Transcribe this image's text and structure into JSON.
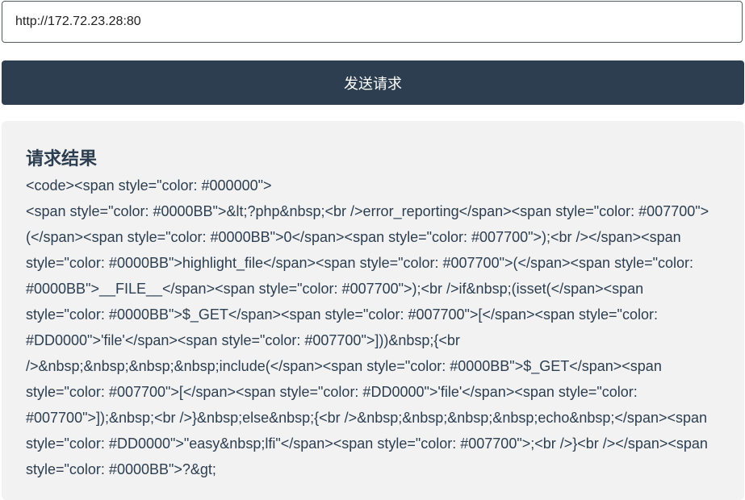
{
  "request": {
    "url_value": "http://172.72.23.28:80",
    "send_label": "发送请求"
  },
  "result": {
    "title": "请求结果",
    "lines": [
      "<code><span style=\"color: #000000\">",
      "<span style=\"color: #0000BB\">&lt;?php&nbsp;<br />error_reporting</span><span style=\"color: #007700\">(</span><span style=\"color: #0000BB\">0</span><span style=\"color: #007700\">);<br /></span><span style=\"color: #0000BB\">highlight_file</span><span style=\"color: #007700\">(</span><span style=\"color: #0000BB\">__FILE__</span><span style=\"color: #007700\">);<br />if&nbsp;(isset(</span><span style=\"color: #0000BB\">$_GET</span><span style=\"color: #007700\">[</span><span style=\"color: #DD0000\">'file'</span><span style=\"color: #007700\">]))&nbsp;{<br />&nbsp;&nbsp;&nbsp;&nbsp;include(</span><span style=\"color: #0000BB\">$_GET</span><span style=\"color: #007700\">[</span><span style=\"color: #DD0000\">'file'</span><span style=\"color: #007700\">]);&nbsp;<br />}&nbsp;else&nbsp;{<br />&nbsp;&nbsp;&nbsp;&nbsp;echo&nbsp;</span><span style=\"color: #DD0000\">\"easy&nbsp;lfi\"</span><span style=\"color: #007700\">;<br />}<br /></span><span style=\"color: #0000BB\">?&gt;"
    ]
  },
  "colors": {
    "button_bg": "#2c3e50",
    "panel_bg": "#f2f2f2",
    "text": "#2c3e50"
  }
}
